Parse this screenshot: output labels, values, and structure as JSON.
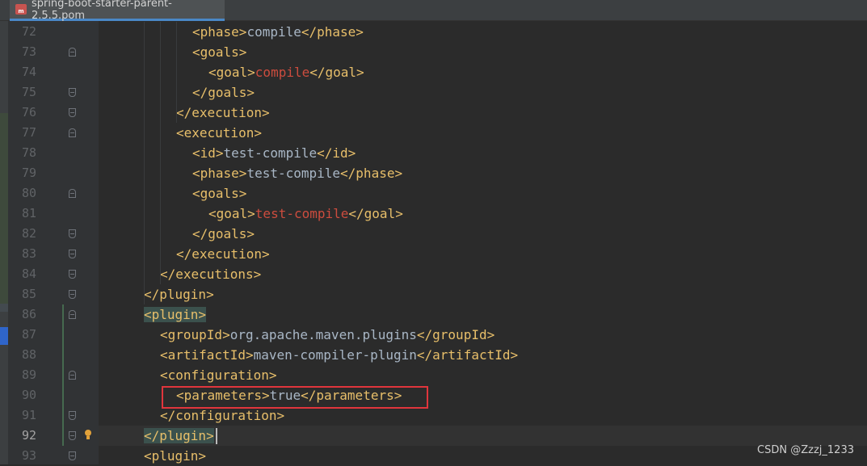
{
  "tab": {
    "label": "spring-boot-starter-parent-2.5.5.pom",
    "icon": "maven-pom-file-icon"
  },
  "editor": {
    "current_line": "92",
    "lines": [
      {
        "num": "72",
        "parts": [
          [
            "t",
            "<phase>"
          ],
          [
            "x",
            "compile"
          ],
          [
            "t",
            "</phase>"
          ]
        ]
      },
      {
        "num": "73",
        "parts": [
          [
            "t",
            "<goals>"
          ]
        ]
      },
      {
        "num": "74",
        "parts": [
          [
            "t",
            "<goal>"
          ],
          [
            "v",
            "compile"
          ],
          [
            "t",
            "</goal>"
          ]
        ]
      },
      {
        "num": "75",
        "parts": [
          [
            "t",
            "</goals>"
          ]
        ]
      },
      {
        "num": "76",
        "parts": [
          [
            "t",
            "</execution>"
          ]
        ]
      },
      {
        "num": "77",
        "parts": [
          [
            "t",
            "<execution>"
          ]
        ]
      },
      {
        "num": "78",
        "parts": [
          [
            "t",
            "<id>"
          ],
          [
            "x",
            "test-compile"
          ],
          [
            "t",
            "</id>"
          ]
        ]
      },
      {
        "num": "79",
        "parts": [
          [
            "t",
            "<phase>"
          ],
          [
            "x",
            "test-compile"
          ],
          [
            "t",
            "</phase>"
          ]
        ]
      },
      {
        "num": "80",
        "parts": [
          [
            "t",
            "<goals>"
          ]
        ]
      },
      {
        "num": "81",
        "parts": [
          [
            "t",
            "<goal>"
          ],
          [
            "v",
            "test-compile"
          ],
          [
            "t",
            "</goal>"
          ]
        ]
      },
      {
        "num": "82",
        "parts": [
          [
            "t",
            "</goals>"
          ]
        ]
      },
      {
        "num": "83",
        "parts": [
          [
            "t",
            "</execution>"
          ]
        ]
      },
      {
        "num": "84",
        "parts": [
          [
            "t",
            "</executions>"
          ]
        ]
      },
      {
        "num": "85",
        "parts": [
          [
            "t",
            "</plugin>"
          ]
        ]
      },
      {
        "num": "86",
        "parts": [
          [
            "h",
            "<plugin>"
          ]
        ]
      },
      {
        "num": "87",
        "parts": [
          [
            "t",
            "<groupId>"
          ],
          [
            "x",
            "org.apache.maven.plugins"
          ],
          [
            "t",
            "</groupId>"
          ]
        ]
      },
      {
        "num": "88",
        "parts": [
          [
            "t",
            "<artifactId>"
          ],
          [
            "x",
            "maven-compiler-plugin"
          ],
          [
            "t",
            "</artifactId>"
          ]
        ]
      },
      {
        "num": "89",
        "parts": [
          [
            "t",
            "<configuration>"
          ]
        ]
      },
      {
        "num": "90",
        "parts": [
          [
            "t",
            "<parameters>"
          ],
          [
            "x",
            "true"
          ],
          [
            "t",
            "</parameters>"
          ]
        ]
      },
      {
        "num": "91",
        "parts": [
          [
            "t",
            "</configuration>"
          ]
        ]
      },
      {
        "num": "92",
        "parts": [
          [
            "h",
            "</plugin>"
          ]
        ]
      },
      {
        "num": "93",
        "parts": [
          [
            "t",
            "<plugin>"
          ]
        ]
      }
    ]
  },
  "watermark": "CSDN @Zzzj_1233",
  "colors": {
    "tag": "#e8bf6a",
    "text": "#a9b7c6",
    "value": "#cc4c3e",
    "highlight_box": "#e0353c"
  }
}
